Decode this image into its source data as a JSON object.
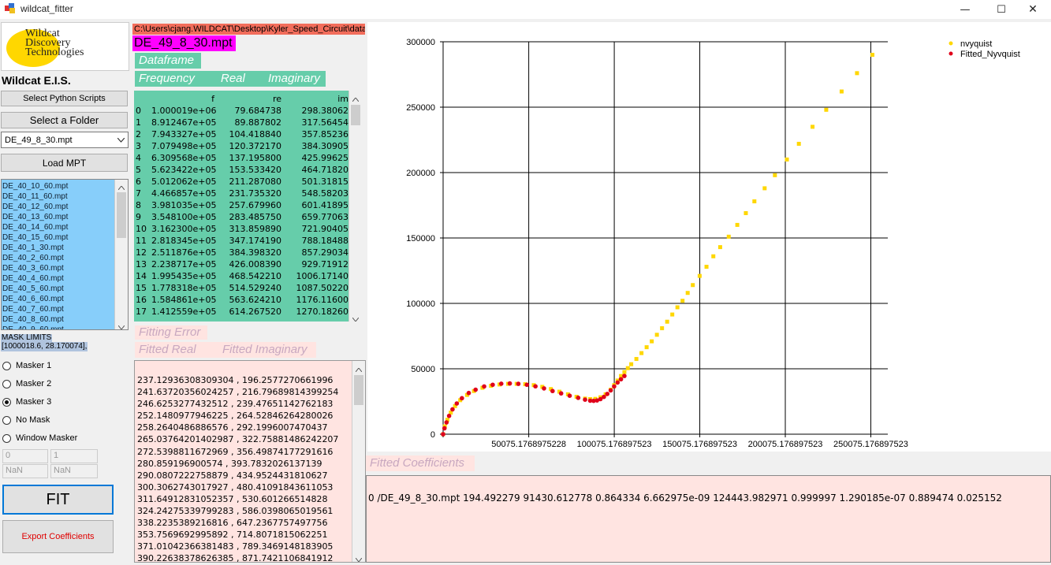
{
  "window": {
    "title": "wildcat_fitter",
    "minimize": "—",
    "maximize": "☐",
    "close": "✕"
  },
  "colors": {
    "path_bg": "#f26d5b",
    "file_bg": "#ff00ff",
    "green_panel": "#66cdaa",
    "list_bg": "#87cefa",
    "pink_panel": "#ffe4e1",
    "nvyquist": "#ffd700",
    "fitted": "#e0001a"
  },
  "logo": {
    "line1": "Wildcat",
    "line2": "Discovery",
    "line3": "Technologies"
  },
  "sidebar": {
    "heading": "Wildcat E.I.S.",
    "select_scripts": "Select Python Scripts",
    "select_folder": "Select a Folder",
    "folder_value": "DE_49_8_30.mpt",
    "load_mpt": "Load MPT",
    "files": [
      "DE_40_10_60.mpt",
      "DE_40_11_60.mpt",
      "DE_40_12_60.mpt",
      "DE_40_13_60.mpt",
      "DE_40_14_60.mpt",
      "DE_40_15_60.mpt",
      "DE_40_1_30.mpt",
      "DE_40_2_60.mpt",
      "DE_40_3_60.mpt",
      "DE_40_4_60.mpt",
      "DE_40_5_60.mpt",
      "DE_40_6_60.mpt",
      "DE_40_7_60.mpt",
      "DE_40_8_60.mpt",
      "DE_40_9_60.mpt"
    ],
    "mask_limits_label": "MASK LIMITS",
    "mask_limits_value": "[1000018.6, 28.170074],",
    "radios": [
      {
        "label": "Masker 1",
        "checked": false
      },
      {
        "label": "Masker 2",
        "checked": false
      },
      {
        "label": "Masker 3",
        "checked": true
      },
      {
        "label": "No Mask",
        "checked": false
      },
      {
        "label": "Window Masker",
        "checked": false
      }
    ],
    "input1": "0",
    "input2": "1",
    "nan1": "NaN",
    "nan2": "NaN",
    "fit": "FIT",
    "export": "Export Coefficients"
  },
  "main": {
    "path": "C:\\Users\\cjang.WILDCAT\\Desktop\\Kyler_Speed_Circuit\\data",
    "file": "DE_49_8_30.mpt",
    "dataframe_label": "Dataframe",
    "frequency_label": "Frequency",
    "real_label": "Real",
    "imag_label": "Imaginary",
    "table_headers": [
      "",
      "f",
      "re",
      "im"
    ],
    "rows": [
      [
        "0",
        "1.000019e+06",
        "79.684738",
        "298.38062"
      ],
      [
        "1",
        "8.912467e+05",
        "89.887802",
        "317.56454"
      ],
      [
        "2",
        "7.943327e+05",
        "104.418840",
        "357.85236"
      ],
      [
        "3",
        "7.079498e+05",
        "120.372170",
        "384.30905"
      ],
      [
        "4",
        "6.309568e+05",
        "137.195800",
        "425.99625"
      ],
      [
        "5",
        "5.623422e+05",
        "153.533420",
        "464.71820"
      ],
      [
        "6",
        "5.012062e+05",
        "211.287080",
        "501.31815"
      ],
      [
        "7",
        "4.466857e+05",
        "231.735320",
        "548.58203"
      ],
      [
        "8",
        "3.981035e+05",
        "257.679960",
        "601.41895"
      ],
      [
        "9",
        "3.548100e+05",
        "283.485750",
        "659.77063"
      ],
      [
        "10",
        "3.162300e+05",
        "313.859890",
        "721.90405"
      ],
      [
        "11",
        "2.818345e+05",
        "347.174190",
        "788.18488"
      ],
      [
        "12",
        "2.511876e+05",
        "384.398320",
        "857.29034"
      ],
      [
        "13",
        "2.238717e+05",
        "426.008390",
        "929.71912"
      ],
      [
        "14",
        "1.995435e+05",
        "468.542210",
        "1006.17140"
      ],
      [
        "15",
        "1.778318e+05",
        "514.529240",
        "1087.50220"
      ],
      [
        "16",
        "1.584861e+05",
        "563.624210",
        "1176.11600"
      ],
      [
        "17",
        "1.412559e+05",
        "614.267520",
        "1270.18260"
      ]
    ],
    "fitting_error_label": "Fitting Error",
    "fitted_real_label": "Fitted Real",
    "fitted_imag_label": "Fitted Imaginary",
    "fitted_rows": [
      "237.12936308309304 ,  196.2577270661996",
      "241.63720356024257 ,  216.79689814399254",
      "246.6253277432512 ,  239.47651142762183",
      "252.1480977946225 ,  264.52846264280026",
      "258.2640486886576 ,  292.1996007470437",
      "265.03764201402987 ,  322.75881486242207",
      "272.5398811672969 ,  356.49874177291616",
      "280.859196900574 ,  393.7832026137139",
      "290.0807222758879 ,  434.9524431810627",
      "300.3062743017927 ,  480.41091843611053",
      "311.64912831052357 ,  530.601266514828",
      "324.24275339799283 ,  586.0398065019561",
      "338.2235389216816 ,  647.2367757497756",
      "353.7569692995892 ,  714.8071815062251",
      "371.01042366381483 ,  789.3469148183905",
      "390.22638378626385 ,  871.7421106841912"
    ],
    "fitted_coeff_label": "Fitted Coefficients",
    "fitted_coeff_text": "0  /DE_49_8_30.mpt  194.492279  91430.612778  0.864334  6.662975e-09  124443.982971  0.999997  1.290185e-07  0.889474  0.025152"
  },
  "chart_data": {
    "type": "scatter",
    "xlim": [
      0,
      260000
    ],
    "ylim": [
      0,
      300000
    ],
    "xticks": [
      50075.1768975228,
      100075.176897523,
      150075.176897523,
      200075.176897523,
      250075.176897523
    ],
    "xtick_labels": [
      "50075.1768975228",
      "100075.176897523",
      "150075.176897523",
      "200075.176897523",
      "250075.176897523"
    ],
    "yticks": [
      0,
      50000,
      100000,
      150000,
      200000,
      250000,
      300000
    ],
    "ytick_labels": [
      "0",
      "50000",
      "100000",
      "150000",
      "200000",
      "250000",
      "300000"
    ],
    "grid": true,
    "legend_position": "top-right",
    "series": [
      {
        "name": "nvyquist",
        "color": "#ffd700",
        "x": [
          0,
          1000,
          2500,
          4500,
          7000,
          10000,
          14000,
          18000,
          23000,
          28000,
          33000,
          38000,
          43000,
          48000,
          53000,
          58000,
          63000,
          68000,
          73000,
          78000,
          83000,
          86000,
          89000,
          92000,
          95000,
          98000,
          100000,
          102000,
          104000,
          106000,
          108000,
          110000,
          113000,
          116000,
          119000,
          122000,
          125000,
          128000,
          131000,
          134000,
          137000,
          140000,
          143000,
          146000,
          150000,
          154000,
          158000,
          162000,
          167000,
          172000,
          177000,
          182000,
          188000,
          194000,
          201000,
          208000,
          216000,
          224000,
          233000,
          242000,
          251000,
          260000
        ],
        "y": [
          0,
          6000,
          11000,
          16500,
          21500,
          26000,
          30000,
          33000,
          35500,
          37000,
          38000,
          38500,
          38500,
          38200,
          37500,
          36200,
          34500,
          32500,
          30500,
          28600,
          27200,
          26800,
          27000,
          28200,
          30500,
          34000,
          37500,
          41000,
          44500,
          47500,
          50500,
          53500,
          57500,
          62000,
          66500,
          71000,
          76000,
          81000,
          86000,
          91500,
          97000,
          102000,
          108000,
          114000,
          121000,
          128000,
          136000,
          143000,
          151000,
          160000,
          169000,
          178000,
          188000,
          198000,
          210000,
          222000,
          235000,
          248000,
          262000,
          276000,
          290000,
          305000
        ]
      },
      {
        "name": "Fitted_Nyvquist",
        "color": "#e0001a",
        "x": [
          0,
          800,
          2000,
          3500,
          5500,
          8000,
          11000,
          15000,
          19000,
          24000,
          29000,
          34000,
          39000,
          44000,
          49000,
          54000,
          59000,
          64000,
          69000,
          74000,
          79000,
          83000,
          86000,
          88000,
          90000,
          92000,
          94000,
          96000,
          98000,
          100000,
          102000,
          104000,
          106000
        ],
        "y": [
          0,
          4500,
          9000,
          14000,
          19000,
          23500,
          27500,
          31500,
          34000,
          36500,
          37800,
          38600,
          38800,
          38500,
          37800,
          36600,
          35000,
          33000,
          31200,
          29400,
          27800,
          26400,
          25600,
          25500,
          25800,
          26800,
          28500,
          30800,
          33500,
          36500,
          39500,
          42000,
          44500
        ]
      }
    ]
  }
}
